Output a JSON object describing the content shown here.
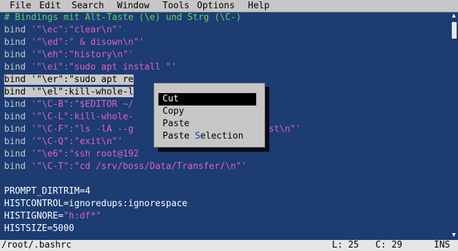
{
  "menu": {
    "items": [
      {
        "label": "File"
      },
      {
        "label": "Edit"
      },
      {
        "label": "Search"
      },
      {
        "label": "Window"
      },
      {
        "label": "Tools"
      },
      {
        "label": "Options"
      },
      {
        "label": "Help"
      }
    ]
  },
  "editor": {
    "comment": "# Bindings mit Alt-Taste (\\e) und Strg (\\C-)",
    "lines": [
      {
        "kw": "bind",
        "str": "'\"\\ec\":\"clear\\n\"'"
      },
      {
        "kw": "bind",
        "str": "'\"\\ed\":\" & disown\\n\"'"
      },
      {
        "kw": "bind",
        "str": "'\"\\eh\":\"history\\n\"'"
      },
      {
        "kw": "bind",
        "str": "'\"\\ei\":\"sudo apt install \"'"
      },
      {
        "kw": "bind",
        "str": "'\"\\er\":\"sudo apt re"
      },
      {
        "kw": "bind",
        "str": "'\"\\el\":kill-whole-l"
      },
      {
        "kw": "bind",
        "str": "'\"\\C-B\":\"$EDITOR ~/"
      },
      {
        "kw": "bind",
        "str": "'\"\\C-L\":kill-whole-"
      },
      {
        "kw": "bind",
        "str": "'\"\\C-F\":\"ls -lA --g",
        "tail": "st\\n\"'"
      },
      {
        "kw": "bind",
        "str": "'\"\\C-Q\":\"exit\\n\"'"
      },
      {
        "kw": "bind",
        "str": "'\"\\e6\":\"ssh root@192"
      },
      {
        "kw": "bind",
        "str": "'\"\\C-T\":\"cd /srv/boss/Data/Transfer/\\n\"'"
      }
    ],
    "prompt_dirtrim": "PROMPT_DIRTRIM=4",
    "histcontrol": "HISTCONTROL=ignoredups:ignorespace",
    "histignore_key": "HISTIGNORE=",
    "histignore_val": "\"h:df*\"",
    "histsize": "HISTSIZE=5000"
  },
  "context_menu": {
    "cut": "Cut",
    "copy": "Copy",
    "paste": "Paste",
    "paste_selection_a": "Paste ",
    "paste_selection_b": "S",
    "paste_selection_c": "election"
  },
  "status": {
    "file": "/root/.bashrc",
    "line": "L: 25",
    "col": "C: 29",
    "mode": "INS"
  }
}
